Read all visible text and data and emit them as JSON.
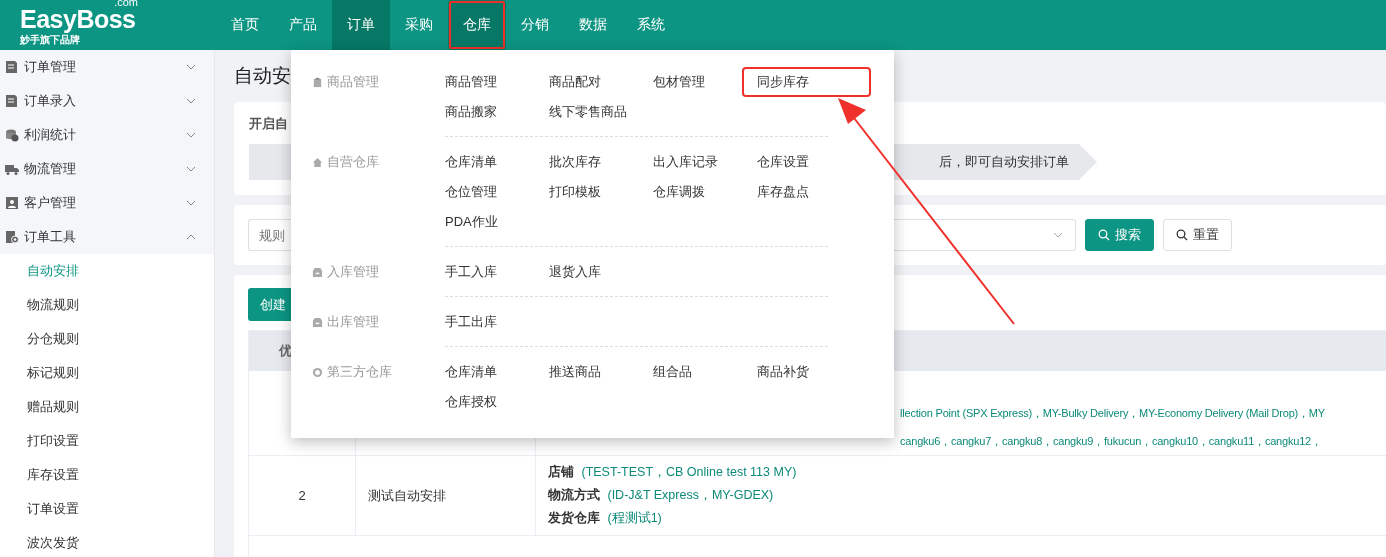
{
  "logo": {
    "name": "EasyBoss",
    "suffix": ".com",
    "tagline": "妙手旗下品牌"
  },
  "nav": [
    {
      "label": "首页",
      "selected": false,
      "highlighted": false
    },
    {
      "label": "产品",
      "selected": false,
      "highlighted": false
    },
    {
      "label": "订单",
      "selected": true,
      "highlighted": false
    },
    {
      "label": "采购",
      "selected": false,
      "highlighted": false
    },
    {
      "label": "仓库",
      "selected": true,
      "highlighted": true
    },
    {
      "label": "分销",
      "selected": false,
      "highlighted": false
    },
    {
      "label": "数据",
      "selected": false,
      "highlighted": false
    },
    {
      "label": "系统",
      "selected": false,
      "highlighted": false
    }
  ],
  "sidebar": {
    "groups": [
      {
        "label": "订单管理",
        "expanded": false
      },
      {
        "label": "订单录入",
        "expanded": false
      },
      {
        "label": "利润统计",
        "expanded": false
      },
      {
        "label": "物流管理",
        "expanded": false
      },
      {
        "label": "客户管理",
        "expanded": false
      },
      {
        "label": "订单工具",
        "expanded": true,
        "children": [
          {
            "label": "自动安排",
            "selected": true
          },
          {
            "label": "物流规则",
            "selected": false
          },
          {
            "label": "分仓规则",
            "selected": false
          },
          {
            "label": "标记规则",
            "selected": false
          },
          {
            "label": "赠品规则",
            "selected": false
          },
          {
            "label": "打印设置",
            "selected": false
          },
          {
            "label": "库存设置",
            "selected": false
          },
          {
            "label": "订单设置",
            "selected": false
          },
          {
            "label": "波次发货",
            "selected": false
          }
        ]
      }
    ]
  },
  "page": {
    "title": "自动安",
    "intro_title": "开启自",
    "step_text": "后，即可自动安排订单",
    "filter": {
      "placeholder": "规则",
      "search": "搜索",
      "reset": "重置"
    },
    "create_button": "创建",
    "table": {
      "columns": [
        "优"
      ],
      "rows": [
        {
          "details": [
            {
              "value": "llection Point (SPX Express)，MY-Bulky Delivery，MY-Economy Delivery (Mail Drop)，MY"
            },
            {
              "value": "cangku6，cangku7，cangku8，cangku9，fukucun，cangku10，cangku11，cangku12，"
            }
          ]
        },
        {
          "column_1": "2",
          "column_2": "测试自动安排",
          "details": [
            {
              "label": "店铺",
              "value": "(TEST-TEST，CB Online test 113 MY)"
            },
            {
              "label": "物流方式",
              "value": "(ID-J&T Express，MY-GDEX)"
            },
            {
              "label": "发货仓库",
              "value": "(程测试1)"
            }
          ]
        }
      ]
    }
  },
  "dropdown": {
    "sections": [
      {
        "label": "商品管理",
        "items": [
          {
            "label": "商品管理",
            "highlighted": false
          },
          {
            "label": "商品配对",
            "highlighted": false
          },
          {
            "label": "包材管理",
            "highlighted": false
          },
          {
            "label": "同步库存",
            "highlighted": true
          },
          {
            "label": "商品搬家",
            "highlighted": false
          },
          {
            "label": "线下零售商品",
            "highlighted": false
          }
        ]
      },
      {
        "label": "自营仓库",
        "items": [
          {
            "label": "仓库清单",
            "highlighted": false
          },
          {
            "label": "批次库存",
            "highlighted": false
          },
          {
            "label": "出入库记录",
            "highlighted": false
          },
          {
            "label": "仓库设置",
            "highlighted": false
          },
          {
            "label": "仓位管理",
            "highlighted": false
          },
          {
            "label": "打印模板",
            "highlighted": false
          },
          {
            "label": "仓库调拨",
            "highlighted": false
          },
          {
            "label": "库存盘点",
            "highlighted": false
          },
          {
            "label": "PDA作业",
            "highlighted": false
          }
        ]
      },
      {
        "label": "入库管理",
        "items": [
          {
            "label": "手工入库",
            "highlighted": false
          },
          {
            "label": "退货入库",
            "highlighted": false
          }
        ]
      },
      {
        "label": "出库管理",
        "items": [
          {
            "label": "手工出库",
            "highlighted": false
          }
        ]
      },
      {
        "label": "第三方仓库",
        "items": [
          {
            "label": "仓库清单",
            "highlighted": false
          },
          {
            "label": "推送商品",
            "highlighted": false
          },
          {
            "label": "组合品",
            "highlighted": false
          },
          {
            "label": "商品补货",
            "highlighted": false
          },
          {
            "label": "仓库授权",
            "highlighted": false
          }
        ]
      }
    ]
  }
}
